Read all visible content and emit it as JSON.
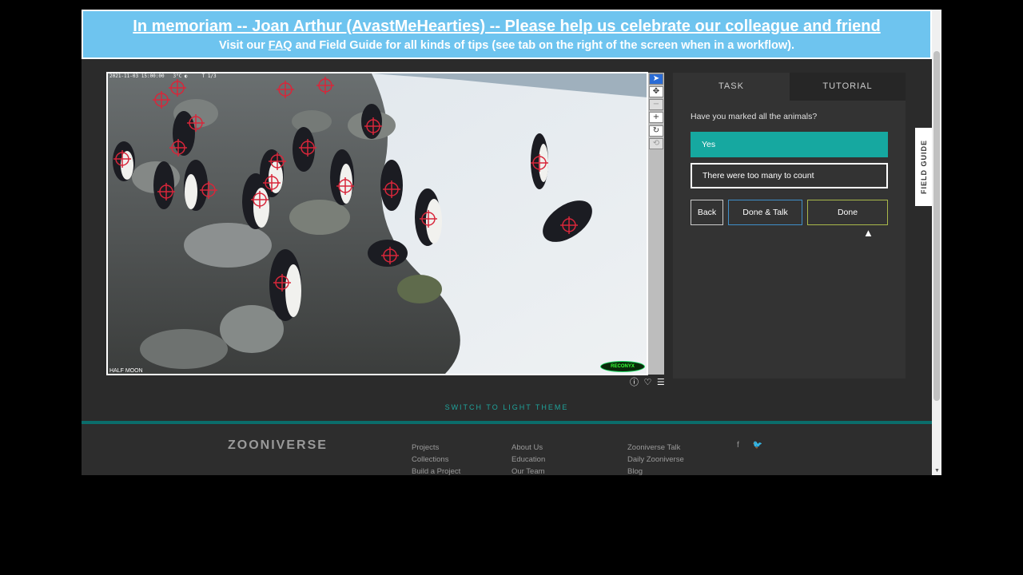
{
  "banner": {
    "line1": "In memoriam -- Joan Arthur (AvastMeHearties) -- Please help us celebrate our colleague and friend",
    "line2_pre": "Visit our ",
    "line2_link": "FAQ",
    "line2_post": " and Field Guide for all kinds of tips (see tab on the right of the screen when in a workflow)."
  },
  "subject": {
    "infobar": "2021-11-03 15:00:00   3°C ◐     T 1/3",
    "location_label": "HALF MOON",
    "camera_brand": "RECONYX"
  },
  "toolbar": {
    "tools": [
      {
        "name": "pointer-icon",
        "glyph": "➤"
      },
      {
        "name": "move-icon",
        "glyph": "✥"
      },
      {
        "name": "zoom-out-icon",
        "glyph": "−"
      },
      {
        "name": "zoom-in-icon",
        "glyph": "+"
      },
      {
        "name": "rotate-icon",
        "glyph": "↻"
      },
      {
        "name": "reset-icon",
        "glyph": "⟲"
      }
    ]
  },
  "subject_actions": {
    "info_glyph": "ⓘ",
    "favorite_glyph": "♡",
    "collect_glyph": "☰"
  },
  "task_panel": {
    "tab_task": "TASK",
    "tab_tutorial": "TUTORIAL",
    "question": "Have you marked all the animals?",
    "answers": [
      "Yes",
      "There were too many to count"
    ],
    "selected_answer": "Yes",
    "back_label": "Back",
    "done_talk_label": "Done & Talk",
    "done_label": "Done"
  },
  "field_guide": {
    "label": "FIELD GUIDE"
  },
  "theme_switch": "SWITCH TO LIGHT THEME",
  "footer": {
    "logo": "ZOONIVERSE",
    "col1": [
      "Projects",
      "Collections",
      "Build a Project"
    ],
    "col2": [
      "About Us",
      "Education",
      "Our Team"
    ],
    "col3": [
      "Zooniverse Talk",
      "Daily Zooniverse",
      "Blog"
    ],
    "social": [
      "f",
      "🐦"
    ]
  },
  "colors": {
    "banner_bg": "#6ec4ef",
    "accent_teal": "#16a8a0",
    "done_talk_border": "#3f8fc9",
    "done_border": "#a9b84a",
    "marker_red": "#d8263a"
  }
}
